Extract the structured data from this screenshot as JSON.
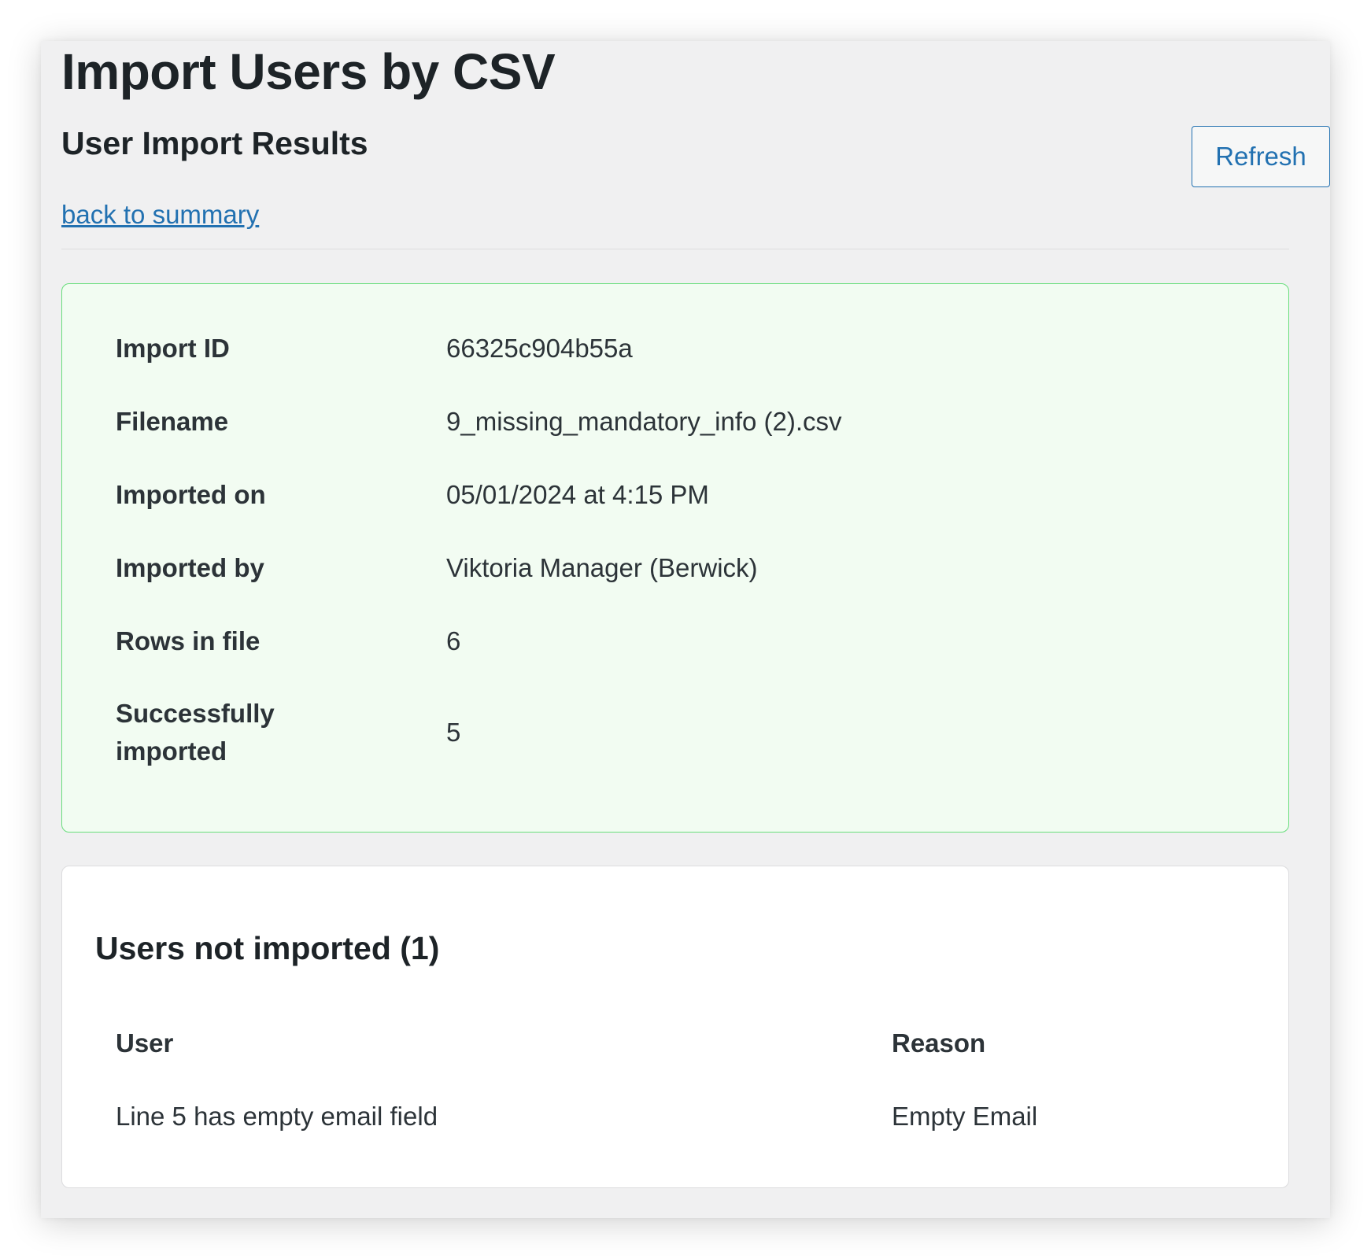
{
  "page": {
    "title": "Import Users by CSV",
    "section_title": "User Import Results",
    "refresh_label": "Refresh",
    "back_link": "back to summary"
  },
  "summary": {
    "rows": [
      {
        "label": "Import ID",
        "value": "66325c904b55a"
      },
      {
        "label": "Filename",
        "value": "9_missing_mandatory_info (2).csv"
      },
      {
        "label": "Imported on",
        "value": "05/01/2024 at 4:15 PM"
      },
      {
        "label": "Imported by",
        "value": "Viktoria Manager (Berwick)"
      },
      {
        "label": "Rows in file",
        "value": "6"
      },
      {
        "label_lines": [
          "Successfully",
          "imported"
        ],
        "value": "5"
      }
    ]
  },
  "failures": {
    "title": "Users not imported (1)",
    "columns": [
      "User",
      "Reason"
    ],
    "rows": [
      {
        "user": "Line 5 has empty email field",
        "reason": "Empty Email"
      }
    ]
  },
  "colors": {
    "accent": "#2271b1",
    "success_border": "#68de7c",
    "success_background": "#f2fcf2",
    "text": "#1d2327"
  }
}
